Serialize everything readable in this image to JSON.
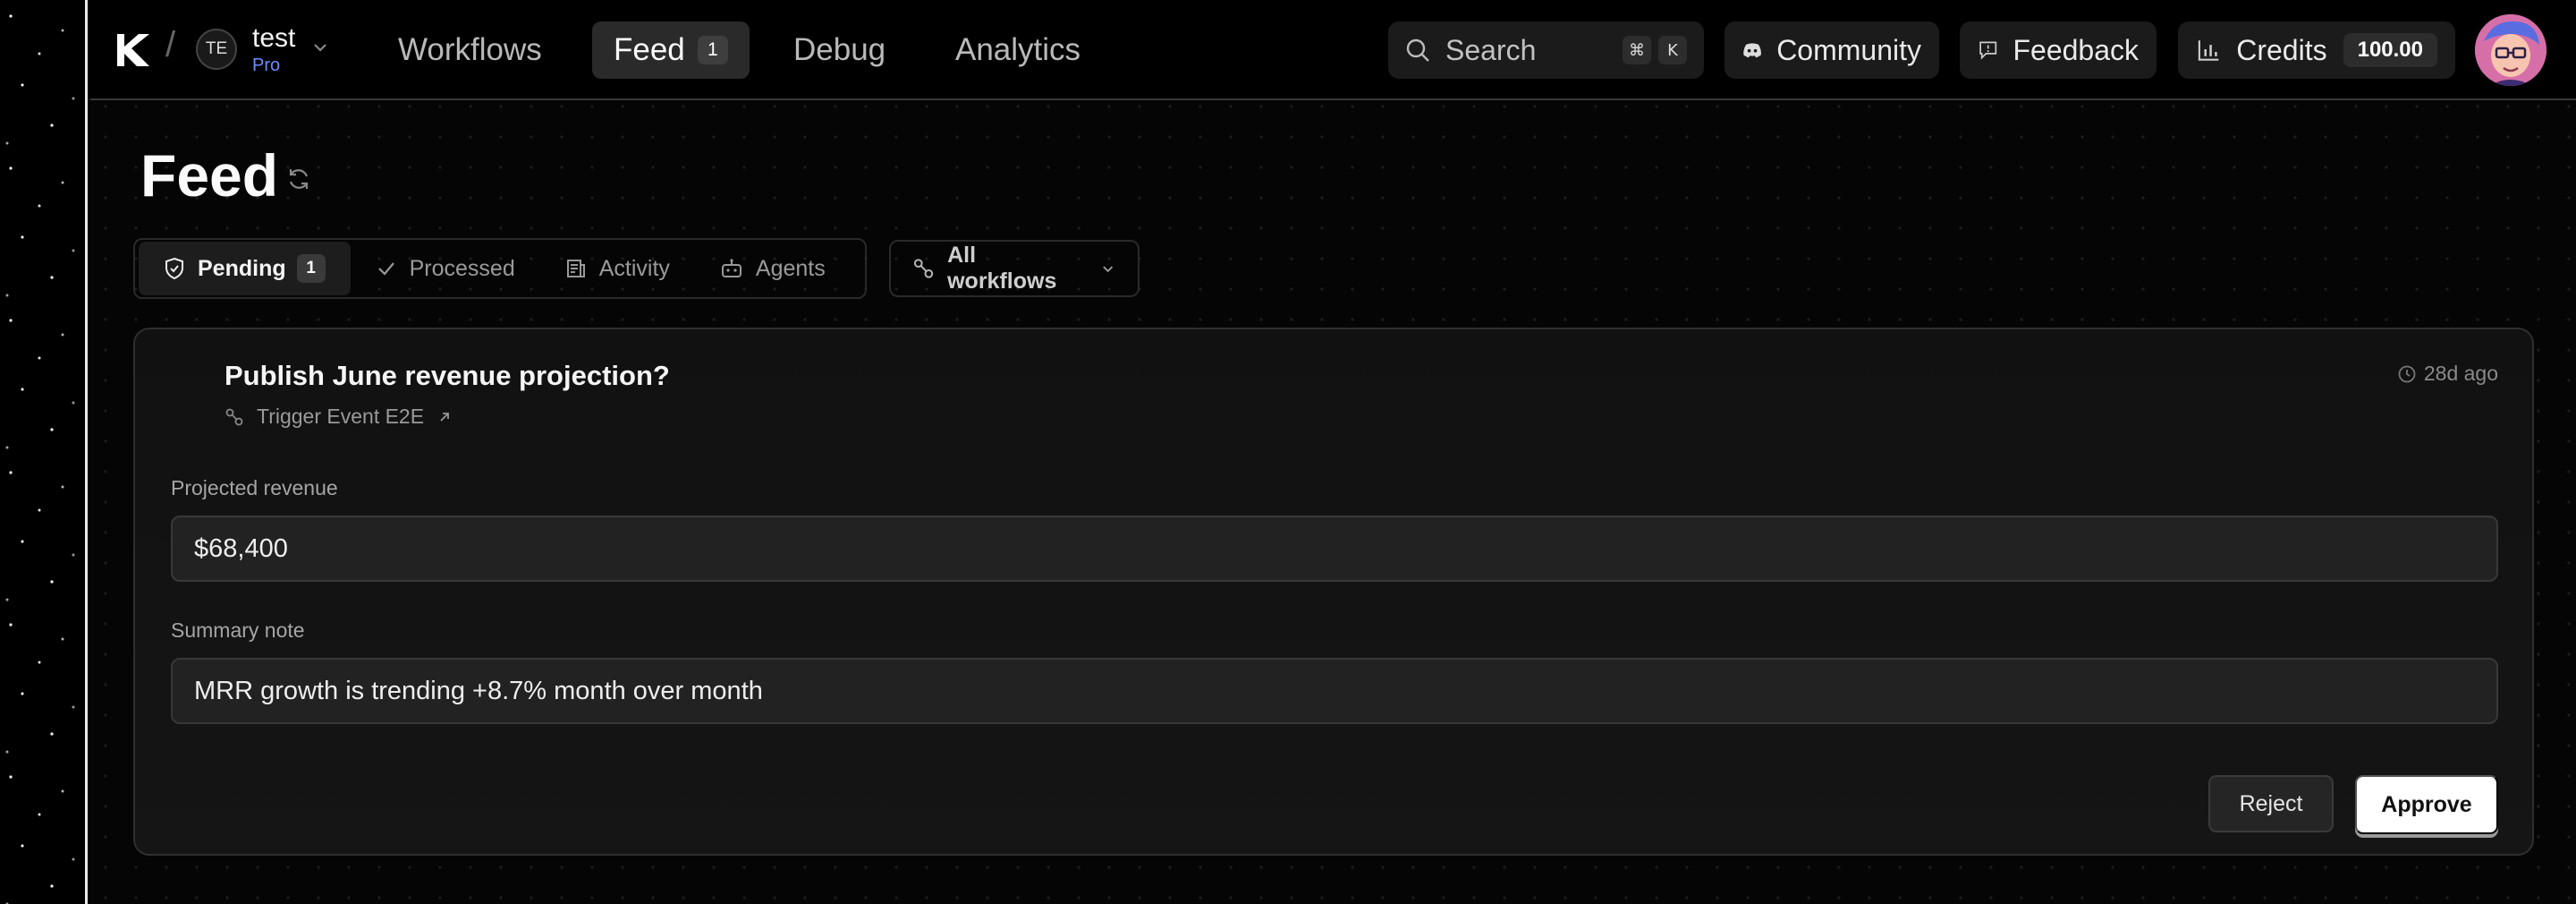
{
  "workspace": {
    "initials": "TE",
    "name": "test",
    "plan": "Pro"
  },
  "nav": {
    "items": [
      {
        "label": "Workflows"
      },
      {
        "label": "Feed",
        "badge": "1"
      },
      {
        "label": "Debug"
      },
      {
        "label": "Analytics"
      }
    ]
  },
  "search": {
    "label": "Search",
    "shortcut_mod": "⌘",
    "shortcut_key": "K"
  },
  "header_buttons": {
    "community": "Community",
    "feedback": "Feedback",
    "credits_label": "Credits",
    "credits_value": "100.00"
  },
  "page": {
    "title": "Feed"
  },
  "tabs": [
    {
      "label": "Pending",
      "badge": "1",
      "icon": "shield-check-icon"
    },
    {
      "label": "Processed",
      "icon": "check-icon"
    },
    {
      "label": "Activity",
      "icon": "activity-icon"
    },
    {
      "label": "Agents",
      "icon": "robot-icon"
    }
  ],
  "workflow_filter": {
    "label": "All workflows"
  },
  "card": {
    "title": "Publish June revenue projection?",
    "workflow": "Trigger Event E2E",
    "time": "28d ago",
    "fields": [
      {
        "label": "Projected revenue",
        "value": "$68,400"
      },
      {
        "label": "Summary note",
        "value": "MRR growth is trending +8.7% month over month"
      }
    ],
    "reject_label": "Reject",
    "approve_label": "Approve"
  },
  "colors": {
    "accent_plan": "#6c8cff",
    "background": "#000000",
    "card": "#131313"
  }
}
